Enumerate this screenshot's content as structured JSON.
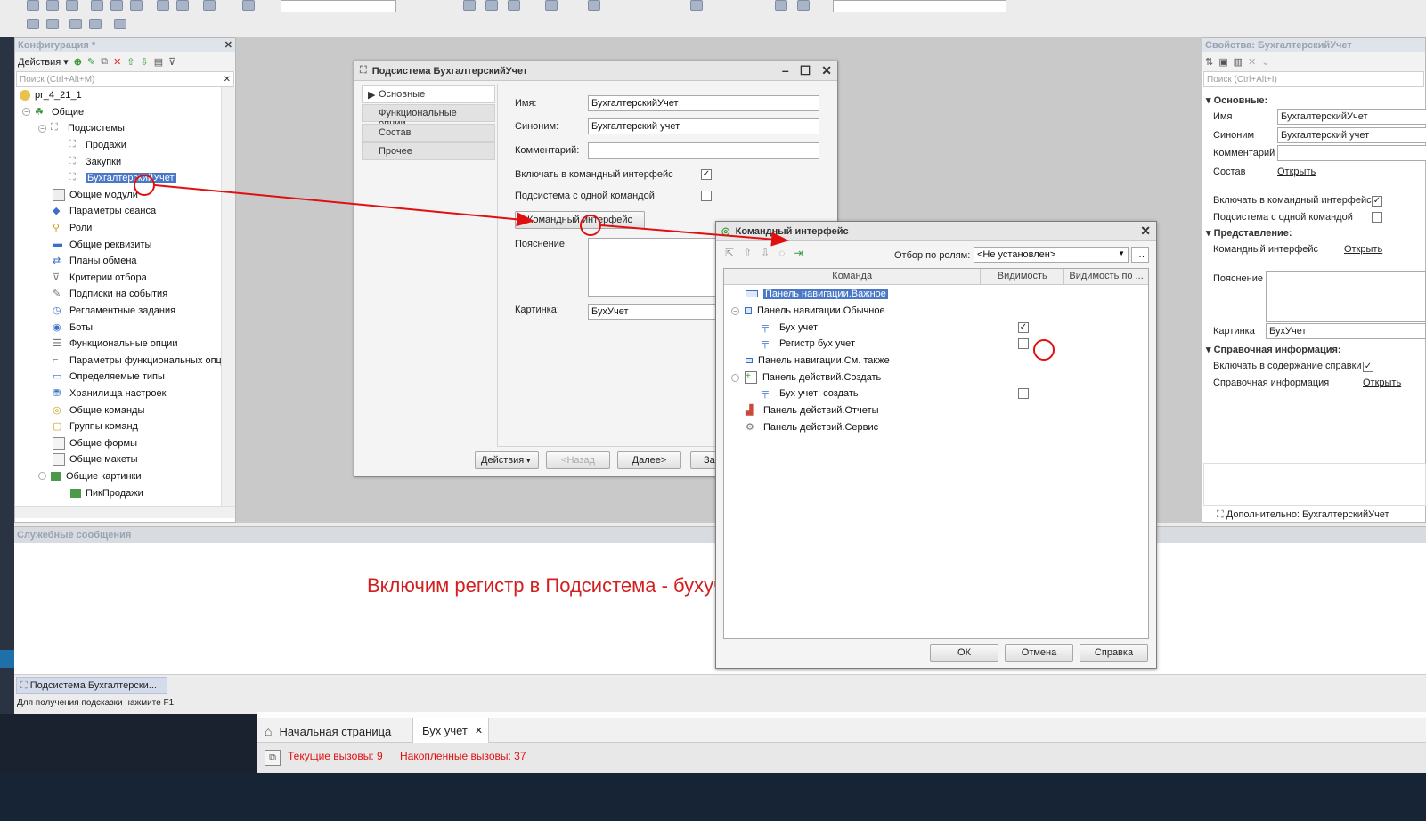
{
  "config_panel": {
    "title": "Конфигурация *",
    "actions_label": "Действия",
    "search_placeholder": "Поиск (Ctrl+Alt+M)",
    "tree": [
      {
        "label": "pr_4_21_1"
      },
      {
        "label": "Общие"
      },
      {
        "label": "Подсистемы"
      },
      {
        "label": "Продажи"
      },
      {
        "label": "Закупки"
      },
      {
        "label": "БухгалтерскийУчет"
      },
      {
        "label": "Общие модули"
      },
      {
        "label": "Параметры сеанса"
      },
      {
        "label": "Роли"
      },
      {
        "label": "Общие реквизиты"
      },
      {
        "label": "Планы обмена"
      },
      {
        "label": "Критерии отбора"
      },
      {
        "label": "Подписки на события"
      },
      {
        "label": "Регламентные задания"
      },
      {
        "label": "Боты"
      },
      {
        "label": "Функциональные опции"
      },
      {
        "label": "Параметры функциональных опц"
      },
      {
        "label": "Определяемые типы"
      },
      {
        "label": "Хранилища настроек"
      },
      {
        "label": "Общие команды"
      },
      {
        "label": "Группы команд"
      },
      {
        "label": "Общие формы"
      },
      {
        "label": "Общие макеты"
      },
      {
        "label": "Общие картинки"
      },
      {
        "label": "ПикПродажи"
      }
    ]
  },
  "subsystem_window": {
    "title": "Подсистема БухгалтерскийУчет",
    "nav": [
      "Основные",
      "Функциональные опции",
      "Состав",
      "Прочее"
    ],
    "name_label": "Имя:",
    "name_value": "БухгалтерскийУчет",
    "synonym_label": "Синоним:",
    "synonym_value": "Бухгалтерский учет",
    "comment_label": "Комментарий:",
    "include_label": "Включать в командный интерфейс",
    "single_cmd_label": "Подсистема с одной командой",
    "cmd_interface_button": "Командный интерфейс",
    "explanation_label": "Пояснение:",
    "picture_label": "Картинка:",
    "picture_value": "БухУчет",
    "actions_button": "Действия",
    "back_button": "<Назад",
    "next_button": "Далее>",
    "close_button_partial": "За"
  },
  "cmd_window": {
    "title": "Командный интерфейс",
    "role_filter_label": "Отбор по ролям:",
    "role_filter_value": "<Не установлен>",
    "col_command": "Команда",
    "col_visibility": "Видимость",
    "col_visibility_by": "Видимость по ...",
    "rows": [
      {
        "label": "Панель навигации.Важное"
      },
      {
        "label": "Панель навигации.Обычное"
      },
      {
        "label": "Бух учет"
      },
      {
        "label": "Регистр бух учет"
      },
      {
        "label": "Панель навигации.См. также"
      },
      {
        "label": "Панель действий.Создать"
      },
      {
        "label": "Бух учет: создать"
      },
      {
        "label": "Панель действий.Отчеты"
      },
      {
        "label": "Панель действий.Сервис"
      }
    ],
    "ok_button": "ОК",
    "cancel_button": "Отмена",
    "help_button": "Справка"
  },
  "props_panel": {
    "title": "Свойства: БухгалтерскийУчет",
    "search_placeholder": "Поиск (Ctrl+Alt+I)",
    "section_main": "Основные:",
    "name_label": "Имя",
    "name_value": "БухгалтерскийУчет",
    "synonym_label": "Синоним",
    "synonym_value": "Бухгалтерский учет",
    "comment_label": "Комментарий",
    "content_label": "Состав",
    "open_link": "Открыть",
    "include_label": "Включать в командный интерфейс",
    "single_cmd_label": "Подсистема с одной командой",
    "section_view": "Представление:",
    "cmd_interface_label": "Командный интерфейс",
    "explanation_label": "Пояснение",
    "picture_label": "Картинка",
    "picture_value": "БухУчет",
    "section_help": "Справочная информация:",
    "include_help_label": "Включать в содержание справки",
    "help_info_label": "Справочная информация",
    "extra_link": "Дополнительно: БухгалтерскийУчет"
  },
  "messages": {
    "title": "Служебные сообщения",
    "caption": "Включим регистр в Подсистема - бухучет - командный интерфейс"
  },
  "taskbar": {
    "item": "Подсистема Бухгалтерски..."
  },
  "statusbar": {
    "hint": "Для получения подсказки нажмите F1"
  },
  "enterprise": {
    "tab_home": "Начальная страница",
    "tab_active": "Бух учет",
    "current_calls": "Текущие вызовы: 9",
    "accumulated_calls": "Накопленные вызовы: 37"
  },
  "colors": {
    "accent_red": "#e01010",
    "selection": "#4b78c6"
  }
}
